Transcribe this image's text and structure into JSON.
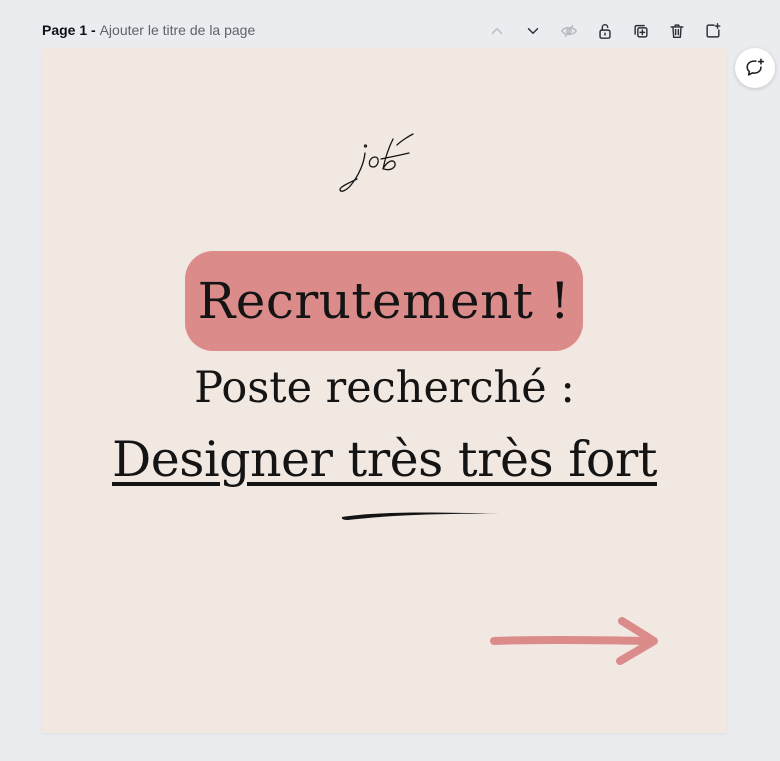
{
  "page": {
    "number_label": "Page 1",
    "separator": " - ",
    "title_placeholder": "Ajouter le titre de la page"
  },
  "toolbar": {
    "icons": [
      "chevron-up-icon",
      "chevron-down-icon",
      "eye-off-icon",
      "lock-icon",
      "duplicate-icon",
      "trash-icon",
      "add-page-icon"
    ]
  },
  "design": {
    "logo_text": "job",
    "pill_text": "Recrutement !",
    "subtitle": "Poste recherché :",
    "headline": "Designer très très fort"
  },
  "colors": {
    "app_background": "#ebecf0",
    "canvas_background": "#f2e8e2",
    "accent_pink": "#dc8b8b",
    "text_dark": "#141414"
  }
}
